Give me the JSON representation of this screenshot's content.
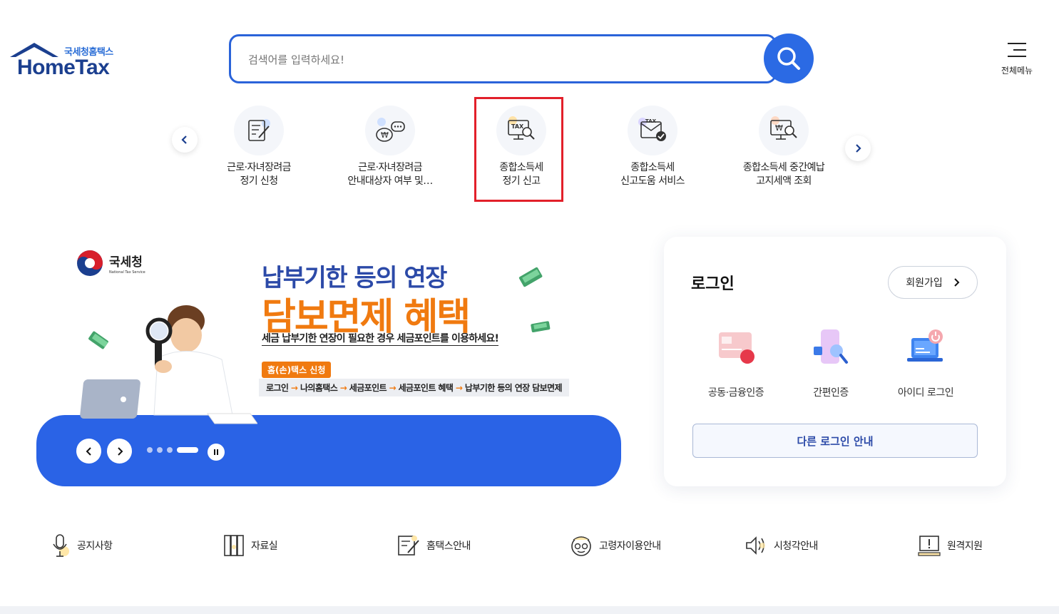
{
  "header": {
    "logo_kor": "국세청홈택스",
    "logo_en": "HomeTax",
    "search_placeholder": "검색어를 입력하세요!",
    "menu_label": "전체메뉴"
  },
  "quick_menu": [
    {
      "line1": "근로·자녀장려금",
      "line2": "정기 신청",
      "icon": "document-pen-icon"
    },
    {
      "line1": "근로·자녀장려금",
      "line2": "안내대상자 여부 및…",
      "icon": "money-bag-chat-icon"
    },
    {
      "line1": "종합소득세",
      "line2": "정기 신고",
      "icon": "tax-monitor-search-icon"
    },
    {
      "line1": "종합소득세",
      "line2": "신고도움 서비스",
      "icon": "tax-envelope-check-icon"
    },
    {
      "line1": "종합소득세 중간예납",
      "line2": "고지세액 조회",
      "icon": "won-monitor-search-icon"
    }
  ],
  "banner": {
    "org_kor": "국세청",
    "org_en": "National Tax Service",
    "line1": "납부기한 등의 연장",
    "line2": "담보면제 혜택",
    "line3": "세금 납부기한 연장이 필요한 경우 세금포인트를 이용하세요!",
    "tag": "홈(손)택스 신청",
    "path": [
      "로그인",
      "나의홈택스",
      "세금포인트",
      "세금포인트 혜택",
      "납부기한 등의 연장 담보면제"
    ],
    "arrow": "→",
    "slide_count": 4,
    "active_slide": 4
  },
  "login": {
    "title": "로그인",
    "signup": "회원가입",
    "options": [
      {
        "label": "공동·금융인증",
        "icon": "certificate-card-icon"
      },
      {
        "label": "간편인증",
        "icon": "phone-search-icon"
      },
      {
        "label": "아이디 로그인",
        "icon": "laptop-power-icon"
      }
    ],
    "other": "다른 로그인 안내"
  },
  "bottom_links": [
    {
      "label": "공지사항",
      "icon": "microphone-icon"
    },
    {
      "label": "자료실",
      "icon": "bookshelf-icon"
    },
    {
      "label": "홈택스안내",
      "icon": "document-pen-icon"
    },
    {
      "label": "고령자이용안내",
      "icon": "elderly-face-icon"
    },
    {
      "label": "시청각안내",
      "icon": "speaker-icon"
    },
    {
      "label": "원격지원",
      "icon": "monitor-alert-icon"
    }
  ],
  "colors": {
    "brand_blue": "#2a63e6",
    "navy": "#2c4aa8",
    "orange": "#f07a10",
    "highlight_red": "#e2202a"
  }
}
